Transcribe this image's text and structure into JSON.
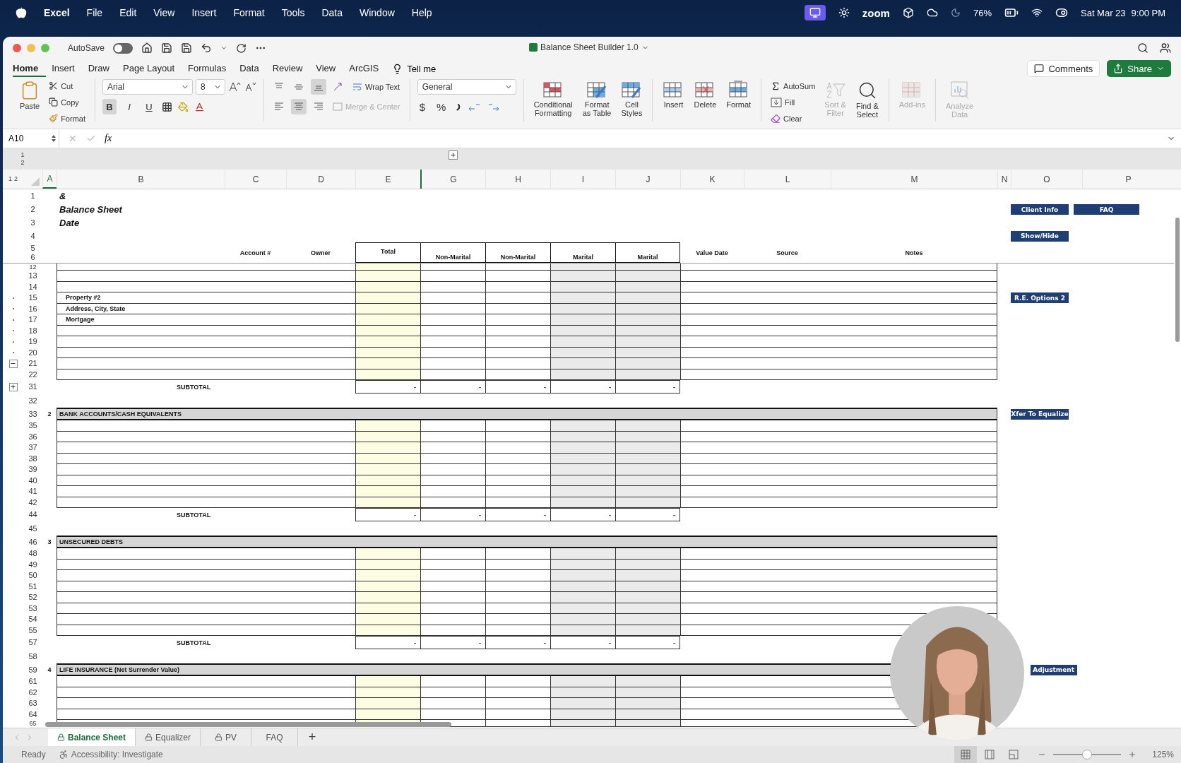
{
  "menu_bar": {
    "app": "Excel",
    "items": [
      "File",
      "Edit",
      "View",
      "Insert",
      "Format",
      "Tools",
      "Data",
      "Window",
      "Help"
    ],
    "zoom_label": "zoom",
    "battery": "76%",
    "date": "Sat Mar 23",
    "time": "9:00 PM"
  },
  "window": {
    "title": "Balance Sheet Builder 1.0",
    "autosave": {
      "label": "AutoSave",
      "on": false
    }
  },
  "ribbon_tabs": [
    {
      "label": "Home",
      "selected": true
    },
    {
      "label": "Insert",
      "selected": false
    },
    {
      "label": "Draw",
      "selected": false
    },
    {
      "label": "Page Layout",
      "selected": false
    },
    {
      "label": "Formulas",
      "selected": false
    },
    {
      "label": "Data",
      "selected": false
    },
    {
      "label": "Review",
      "selected": false
    },
    {
      "label": "View",
      "selected": false
    },
    {
      "label": "ArcGIS",
      "selected": false
    }
  ],
  "tell_me": "Tell me",
  "comments": "Comments",
  "share": "Share",
  "ribbon": {
    "paste": "Paste",
    "clipboard": [
      "Cut",
      "Copy",
      "Format"
    ],
    "font_name": "Arial",
    "font_size": "8",
    "font_styles": [
      {
        "label": "B",
        "on": true
      },
      {
        "label": "I",
        "on": false
      },
      {
        "label": "U",
        "on": false
      }
    ],
    "vertical_align": [
      {
        "on": false
      },
      {
        "on": false
      },
      {
        "on": true
      }
    ],
    "horizontal_align": [
      {
        "on": false
      },
      {
        "on": true
      },
      {
        "on": false
      }
    ],
    "wrap_text": {
      "label": "Wrap Text",
      "disabled": false
    },
    "merge": {
      "label": "Merge & Center",
      "disabled": true
    },
    "number_format": "General",
    "currency": "$",
    "percent": "%",
    "button_groups": [
      [
        {
          "kind": "conditional",
          "label": "Conditional\nFormatting",
          "disabled": false
        },
        {
          "kind": "table",
          "label": "Format\nas Table",
          "disabled": false
        },
        {
          "kind": "styles",
          "label": "Cell\nStyles",
          "disabled": false
        }
      ],
      [
        {
          "kind": "insert",
          "label": "Insert",
          "disabled": false
        },
        {
          "kind": "delete",
          "label": "Delete",
          "disabled": false
        },
        {
          "kind": "format",
          "label": "Format",
          "disabled": false
        }
      ]
    ],
    "editing": [
      {
        "kind": "autosum",
        "label": "AutoSum"
      },
      {
        "kind": "fill",
        "label": "Fill"
      },
      {
        "kind": "clear",
        "label": "Clear"
      }
    ],
    "tail_groups": [
      [
        {
          "kind": "sort",
          "label": "Sort &\nFilter",
          "disabled": true
        },
        {
          "kind": "find",
          "label": "Find &\nSelect",
          "disabled": false
        }
      ],
      [
        {
          "kind": "addins",
          "label": "Add-ins",
          "disabled": true
        }
      ],
      [
        {
          "kind": "analyze",
          "label": "Analyze\nData",
          "disabled": true
        }
      ]
    ]
  },
  "formula_bar": {
    "name_box": "A10",
    "fx": "fx"
  },
  "column_levels": [
    "1",
    "2"
  ],
  "row_levels": [
    "1",
    "2"
  ],
  "columns": [
    {
      "label": "A",
      "selected": true
    },
    {
      "label": "B",
      "selected": false
    },
    {
      "label": "C",
      "selected": false
    },
    {
      "label": "D",
      "selected": false
    },
    {
      "label": "E",
      "selected": false
    },
    {
      "label": "G",
      "selected": false
    },
    {
      "label": "H",
      "selected": false
    },
    {
      "label": "I",
      "selected": false
    },
    {
      "label": "J",
      "selected": false
    },
    {
      "label": "K",
      "selected": false
    },
    {
      "label": "L",
      "selected": false
    },
    {
      "label": "M",
      "selected": false
    },
    {
      "label": "N",
      "selected": false
    },
    {
      "label": "O",
      "selected": false
    },
    {
      "label": "P",
      "selected": false
    }
  ],
  "rows": [
    {
      "n": "1",
      "kind": "title",
      "label": "&"
    },
    {
      "n": "2",
      "kind": "title",
      "label": "Balance Sheet",
      "buttons": [
        "Client Info",
        "FAQ"
      ]
    },
    {
      "n": "3",
      "kind": "title",
      "label": "Date"
    },
    {
      "n": "4",
      "kind": "blank",
      "buttons": [
        "Show/Hide"
      ]
    },
    {
      "n": "5",
      "n_lower": "6",
      "kind": "header",
      "cells": [
        "Account #",
        "Owner",
        "Total",
        "Non-Marital",
        "Non-Marital",
        "Marital",
        "Marital",
        "Value Date",
        "Source",
        "Notes"
      ]
    },
    {
      "n": "12",
      "kind": "data",
      "clipped": true
    },
    {
      "n": "13",
      "kind": "data"
    },
    {
      "n": "14",
      "kind": "data"
    },
    {
      "n": "15",
      "kind": "data",
      "label": "Property #2",
      "grouped": true,
      "buttons": [
        "R.E. Options 2"
      ]
    },
    {
      "n": "16",
      "kind": "data",
      "label": "Address, City, State",
      "grouped": true
    },
    {
      "n": "17",
      "kind": "data",
      "label": "Mortgage",
      "grouped": true
    },
    {
      "n": "18",
      "kind": "data",
      "grouped": true
    },
    {
      "n": "19",
      "kind": "data",
      "grouped": true
    },
    {
      "n": "20",
      "kind": "data",
      "grouped": true
    },
    {
      "n": "21",
      "kind": "data",
      "group_end": true,
      "expanded": true
    },
    {
      "n": "22",
      "kind": "data"
    },
    {
      "n": "31",
      "kind": "subtotal",
      "label": "SUBTOTAL",
      "values": [
        "-",
        "-",
        "-",
        "-",
        "-"
      ],
      "group_end": true,
      "expanded": false
    },
    {
      "n": "32",
      "kind": "gap"
    },
    {
      "n": "33",
      "kind": "section",
      "index": "2",
      "label": "BANK ACCOUNTS/CASH EQUIVALENTS",
      "buttons": [
        "Xfer To Equalize"
      ]
    },
    {
      "n": "35",
      "kind": "data"
    },
    {
      "n": "36",
      "kind": "data"
    },
    {
      "n": "37",
      "kind": "data"
    },
    {
      "n": "38",
      "kind": "data"
    },
    {
      "n": "39",
      "kind": "data"
    },
    {
      "n": "40",
      "kind": "data"
    },
    {
      "n": "41",
      "kind": "data"
    },
    {
      "n": "42",
      "kind": "data"
    },
    {
      "n": "44",
      "kind": "subtotal",
      "label": "SUBTOTAL",
      "values": [
        "-",
        "-",
        "-",
        "-",
        "-"
      ]
    },
    {
      "n": "45",
      "kind": "gap"
    },
    {
      "n": "46",
      "kind": "section",
      "index": "3",
      "label": "UNSECURED DEBTS"
    },
    {
      "n": "48",
      "kind": "data"
    },
    {
      "n": "49",
      "kind": "data"
    },
    {
      "n": "50",
      "kind": "data"
    },
    {
      "n": "51",
      "kind": "data"
    },
    {
      "n": "52",
      "kind": "data"
    },
    {
      "n": "53",
      "kind": "data"
    },
    {
      "n": "54",
      "kind": "data"
    },
    {
      "n": "55",
      "kind": "data"
    },
    {
      "n": "57",
      "kind": "subtotal",
      "label": "SUBTOTAL",
      "values": [
        "-",
        "-",
        "-",
        "-",
        "-"
      ]
    },
    {
      "n": "58",
      "kind": "gap"
    },
    {
      "n": "59",
      "kind": "section",
      "index": "4",
      "label": "LIFE INSURANCE (Net Surrender Value)",
      "buttons": [
        "Adjustment"
      ],
      "button_cut": true
    },
    {
      "n": "61",
      "kind": "data"
    },
    {
      "n": "62",
      "kind": "data"
    },
    {
      "n": "63",
      "kind": "data"
    },
    {
      "n": "64",
      "kind": "data"
    },
    {
      "n": "65",
      "kind": "data",
      "clipped": true
    }
  ],
  "sheet_tabs": [
    {
      "label": "Balance Sheet",
      "selected": true,
      "locked": true
    },
    {
      "label": "Equalizer",
      "selected": false,
      "locked": true
    },
    {
      "label": "PV",
      "selected": false,
      "locked": true
    },
    {
      "label": "FAQ",
      "selected": false,
      "locked": false
    }
  ],
  "add_sheet": "+",
  "status_bar": {
    "ready": "Ready",
    "accessibility": "Accessibility: Investigate",
    "views": [
      {
        "selected": true
      },
      {
        "selected": false
      },
      {
        "selected": false
      }
    ],
    "zoom": {
      "level": 0.5,
      "reading": "125%"
    }
  },
  "webcam": {
    "kind": "picture"
  }
}
